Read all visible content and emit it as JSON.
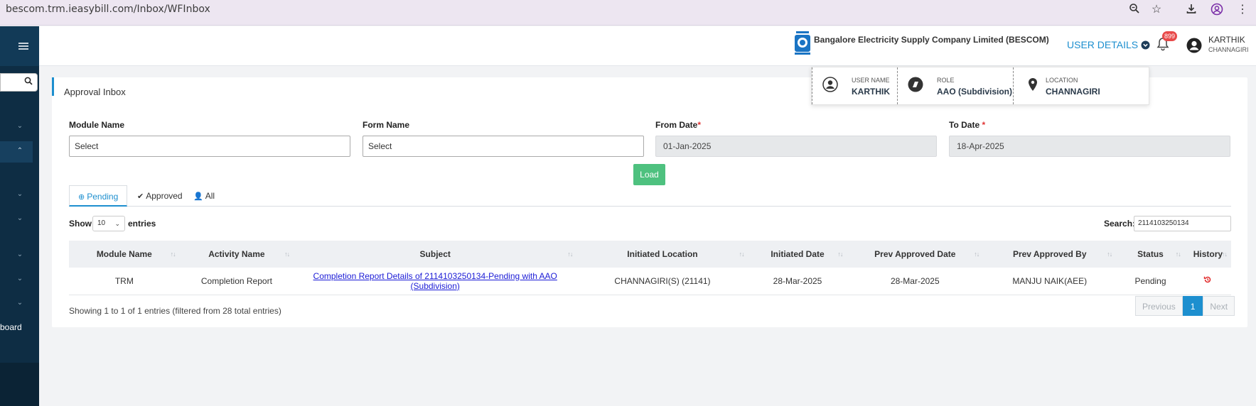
{
  "browser": {
    "url": "bescom.trm.ieasybill.com/Inbox/WFInbox"
  },
  "sidebar": {
    "partial_label": "board"
  },
  "header": {
    "company": "Bangalore Electricity Supply Company Limited (BESCOM)",
    "user_details": "USER DETAILS",
    "notif_count": "899",
    "user_name": "KARTHIK",
    "user_location": "CHANNAGIRI"
  },
  "user_popup": {
    "username_label": "USER NAME",
    "username": "KARTHIK",
    "role_label": "ROLE",
    "role": "AAO (Subdivision)",
    "location_label": "LOCATION",
    "location": "CHANNAGIRI"
  },
  "page": {
    "title": "Approval Inbox"
  },
  "filters": {
    "module_label": "Module Name",
    "module_value": "Select",
    "form_label": "Form Name",
    "form_value": "Select",
    "from_label": "From Date",
    "from_value": "01-Jan-2025",
    "to_label": "To Date",
    "to_value": "18-Apr-2025",
    "load": "Load",
    "required_mark": "*"
  },
  "tabs": {
    "pending": "Pending",
    "approved": "Approved",
    "all": "All"
  },
  "table_controls": {
    "show": "Show",
    "length": "10",
    "entries": "entries",
    "search_label": "Search:",
    "search_value": "2114103250134"
  },
  "table": {
    "headers": [
      "Module Name",
      "Activity Name",
      "Subject",
      "Initiated Location",
      "Initiated Date",
      "Prev Approved Date",
      "Prev Approved By",
      "Status",
      "History"
    ],
    "rows": [
      {
        "module": "TRM",
        "activity": "Completion Report",
        "subject": "Completion Report Details of 2114103250134-Pending with AAO (Subdivision)",
        "location": "CHANNAGIRI(S) (21141)",
        "initiated_date": "28-Mar-2025",
        "prev_date": "28-Mar-2025",
        "prev_by": "MANJU NAIK(AEE)",
        "status": "Pending"
      }
    ]
  },
  "footer": {
    "info": "Showing 1 to 1 of 1 entries (filtered from 28 total entries)",
    "prev": "Previous",
    "page": "1",
    "next": "Next"
  }
}
